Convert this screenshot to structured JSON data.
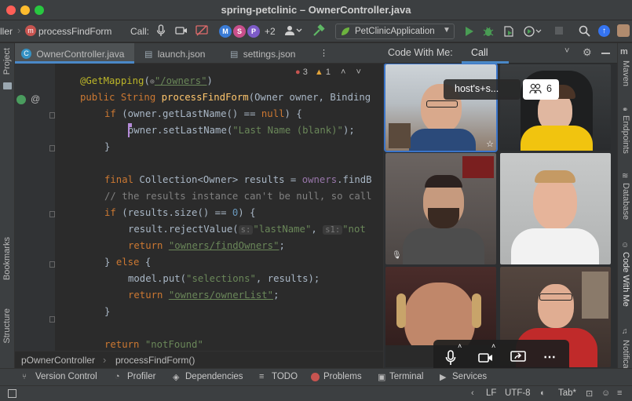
{
  "window": {
    "title": "spring-petclinic – OwnerController.java"
  },
  "navbar": {
    "breadcrumb_class": "ller",
    "method_badge": "m",
    "method_label": "processFindForm",
    "call_label": "Call:",
    "participants": [
      "M",
      "S",
      "P"
    ],
    "participants_extra": "+2",
    "run_config": "PetClinicApplication"
  },
  "editor_tabs": [
    {
      "label": "OwnerController.java",
      "active": true
    },
    {
      "label": "launch.json",
      "active": false
    },
    {
      "label": "settings.json",
      "active": false
    }
  ],
  "inspections": {
    "warnings": "3",
    "weak_warnings": "1"
  },
  "code": {
    "annotation": "@GetMapping",
    "mapping_path": "\"/owners\"",
    "signature_prefix": "public String ",
    "signature_method": "processFindForm",
    "signature_rest": "(Owner owner, Binding",
    "line_if_null_a": "if",
    "line_if_null_b": " (owner.getLastName() == ",
    "line_if_null_c": "null",
    "line_if_null_d": ") {",
    "line_set_a": "owner.setLastName(",
    "line_set_b": "\"Last Name (blank)\"",
    "line_set_c": ");",
    "close_brace": "}",
    "results_a": "final ",
    "results_b": "Collection<Owner> results = ",
    "results_c": "owners",
    "results_d": ".findB",
    "comment": "// the results instance can't be null, so call",
    "size_a": "if",
    "size_b": " (results.size() == ",
    "size_c": "0",
    "size_d": ") {",
    "reject_a": "result.rejectValue(",
    "reject_hint1": "s:",
    "reject_b": "\"lastName\"",
    "reject_c": ", ",
    "reject_hint2": "s1:",
    "reject_d": "\"not",
    "return1_a": "return ",
    "return1_b": "\"owners/findOwners\"",
    "return1_c": ";",
    "else_a": "} ",
    "else_b": "else",
    "else_c": " {",
    "model_a": "model.put(",
    "model_b": "\"selections\"",
    "model_c": ", results);",
    "return2_a": "return ",
    "return2_b": "\"owners/ownerList\"",
    "return2_c": ";",
    "close_brace2": "}",
    "return3_a": "return ",
    "return3_b": "\"notFound\""
  },
  "breadcrumb": {
    "class_name": "pOwnerController",
    "method_name": "processFindForm()"
  },
  "call_panel": {
    "title": "Code With Me:",
    "tab": "Call",
    "host_label": "host's+s...",
    "participant_count": "6"
  },
  "left_tool_windows": [
    "Project",
    "Bookmarks",
    "Structure"
  ],
  "right_tool_windows": [
    "Maven",
    "Endpoints",
    "Database",
    "Code With Me",
    "Notifications"
  ],
  "bottom_tools": [
    "Version Control",
    "Profiler",
    "Dependencies",
    "TODO",
    "Problems",
    "Terminal",
    "Services"
  ],
  "status": {
    "line_separator": "LF",
    "encoding": "UTF-8",
    "indent": "Tab*"
  },
  "colors": {
    "accent": "#3574f0",
    "run_green": "#499c54",
    "avatar_m": "#3a7bd5",
    "avatar_s": "#c94f8b",
    "avatar_p": "#7d5bc7"
  }
}
